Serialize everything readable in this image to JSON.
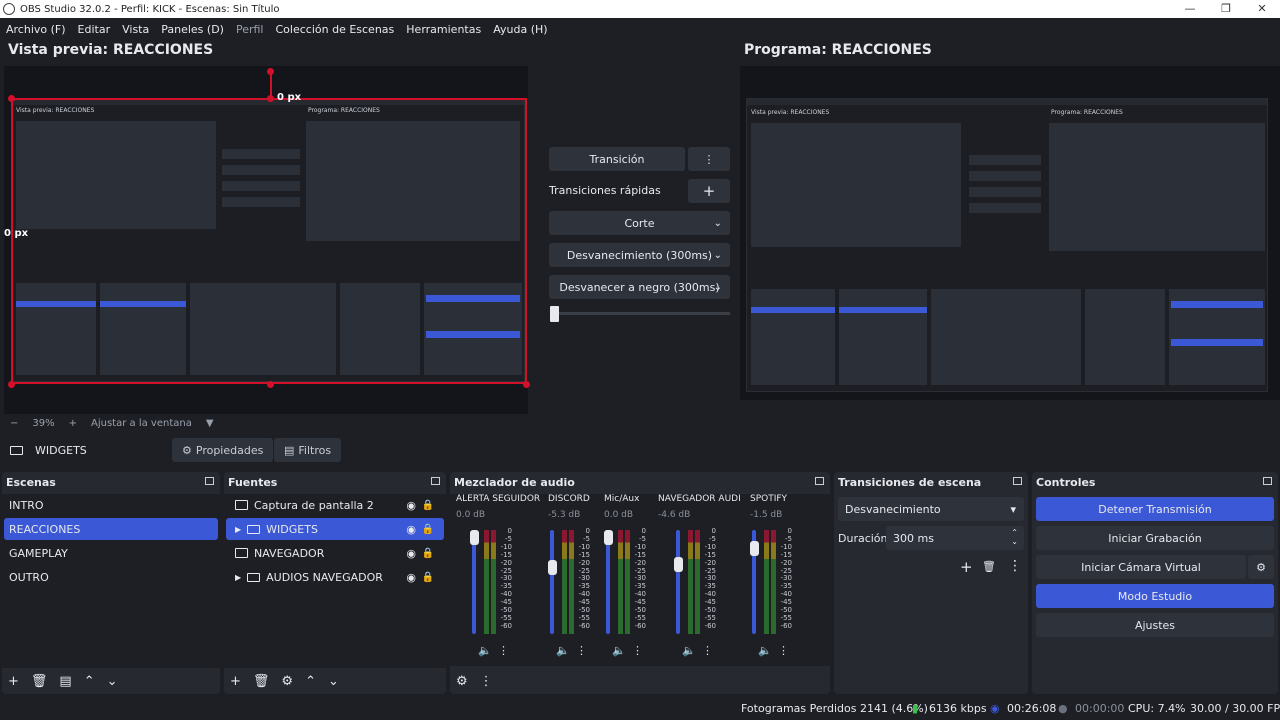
{
  "window": {
    "title": "OBS Studio 32.0.2 - Perfil: KICK - Escenas: Sin Título",
    "controls": [
      "—",
      "❐",
      "✕"
    ]
  },
  "menu": [
    "Archivo (F)",
    "Editar",
    "Vista",
    "Paneles (D)",
    "Perfil",
    "Colección de Escenas",
    "Herramientas",
    "Ayuda (H)"
  ],
  "preview": {
    "title": "Vista previa: REACCIONES",
    "top_offset": "0 px",
    "left_offset": "0 px",
    "zoom": "39%",
    "fit_label": "Ajustar a la ventana"
  },
  "program": {
    "title": "Programa: REACCIONES"
  },
  "transition_panel": {
    "transition_button": "Transición",
    "quick_label": "Transiciones rápidas",
    "quick_items": [
      "Corte",
      "Desvanecimiento (300ms)",
      "Desvanecer a negro (300ms)"
    ]
  },
  "context": {
    "scene_name": "WIDGETS",
    "properties": "Propiedades",
    "filters": "Filtros"
  },
  "scenes": {
    "title": "Escenas",
    "items": [
      "INTRO",
      "REACCIONES",
      "GAMEPLAY",
      "OUTRO"
    ],
    "active_index": 1
  },
  "sources": {
    "title": "Fuentes",
    "items": [
      "Captura de pantalla 2",
      "WIDGETS",
      "NAVEGADOR",
      "AUDIOS NAVEGADOR"
    ]
  },
  "mixer": {
    "title": "Mezclador de audio",
    "channels": [
      {
        "name": "ALERTA SEGUIDOR",
        "db": "0.0 dB",
        "level": 1.0
      },
      {
        "name": "DISCORD",
        "db": "-5.3 dB",
        "level": 0.72
      },
      {
        "name": "Mic/Aux",
        "db": "0.0 dB",
        "level": 1.0
      },
      {
        "name": "NAVEGADOR AUDI",
        "db": "-4.6 dB",
        "level": 0.75
      },
      {
        "name": "SPOTIFY",
        "db": "-1.5 dB",
        "level": 0.9
      }
    ],
    "scale": [
      "0",
      "-5",
      "-10",
      "-15",
      "-20",
      "-25",
      "-30",
      "-35",
      "-40",
      "-45",
      "-50",
      "-55",
      "-60"
    ]
  },
  "scene_transitions": {
    "title": "Transiciones de escena",
    "selected": "Desvanecimiento",
    "duration_label": "Duración",
    "duration_value": "300 ms"
  },
  "controls": {
    "title": "Controles",
    "stop_stream": "Detener Transmisión",
    "start_recording": "Iniciar Grabación",
    "start_virtual_cam": "Iniciar Cámara Virtual",
    "studio_mode": "Modo Estudio",
    "settings": "Ajustes"
  },
  "status": {
    "dropped_frames": "Fotogramas Perdidos 2141 (4.6%)",
    "bitrate": "6136 kbps",
    "stream_time": "00:26:08",
    "record_time": "00:00:00",
    "cpu": "CPU: 7.4%",
    "fps": "30.00 / 30.00 FPS"
  },
  "colors": {
    "accent": "#3b58d6",
    "selection": "#d3102a",
    "panel": "#262930",
    "background": "#1d1f25"
  }
}
